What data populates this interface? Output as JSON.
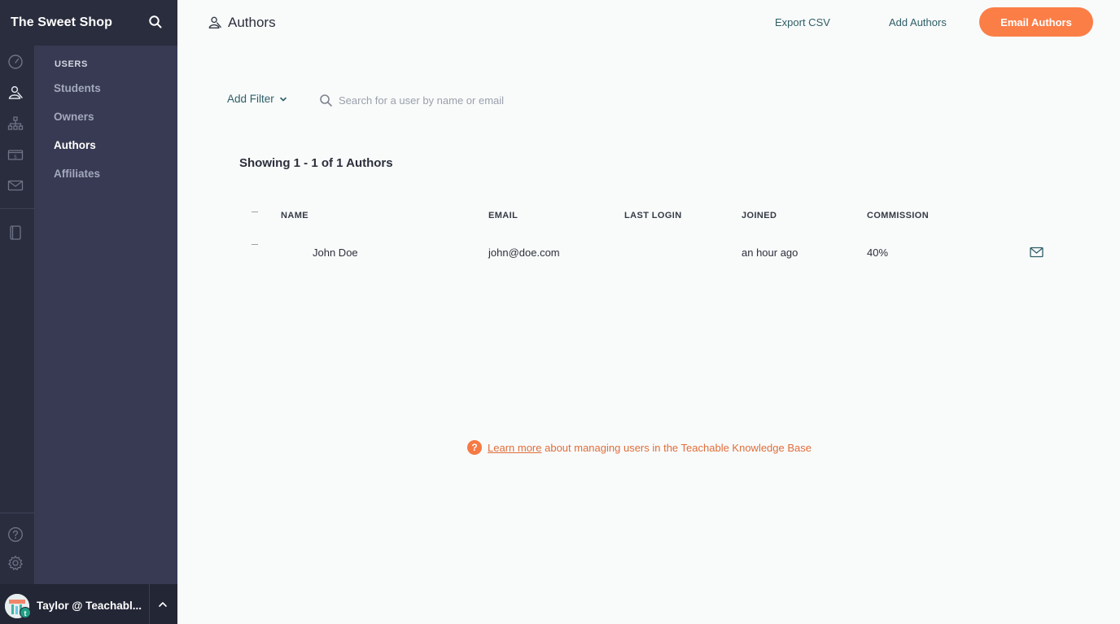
{
  "app": {
    "title": "The Sweet Shop"
  },
  "sidebar": {
    "heading": "USERS",
    "items": [
      {
        "label": "Students",
        "active": false
      },
      {
        "label": "Owners",
        "active": false
      },
      {
        "label": "Authors",
        "active": true
      },
      {
        "label": "Affiliates",
        "active": false
      }
    ],
    "rail_icons": [
      "speedometer-icon",
      "users-icon",
      "sitemap-icon",
      "money-icon",
      "mail-icon",
      "book-icon",
      "help-icon",
      "gear-icon"
    ]
  },
  "user": {
    "name": "Taylor @ Teachabl..."
  },
  "header": {
    "title": "Authors",
    "export_label": "Export CSV",
    "add_label": "Add Authors",
    "email_label": "Email Authors"
  },
  "filter": {
    "add_filter_label": "Add Filter",
    "search_placeholder": "Search for a user by name or email"
  },
  "summary": "Showing 1 - 1 of 1 Authors",
  "table": {
    "columns": [
      "NAME",
      "EMAIL",
      "LAST LOGIN",
      "JOINED",
      "COMMISSION"
    ],
    "rows": [
      {
        "name": "John Doe",
        "email": "john@doe.com",
        "last_login": "",
        "joined": "an hour ago",
        "commission": "40%"
      }
    ]
  },
  "help": {
    "link_text": "Learn more",
    "rest_text": "about managing users in the Teachable Knowledge Base"
  },
  "colors": {
    "accent": "#fb7e47",
    "sidebar_dark": "#2a2d3d",
    "sidebar_sub": "#373a52",
    "link": "#2f5e66"
  }
}
